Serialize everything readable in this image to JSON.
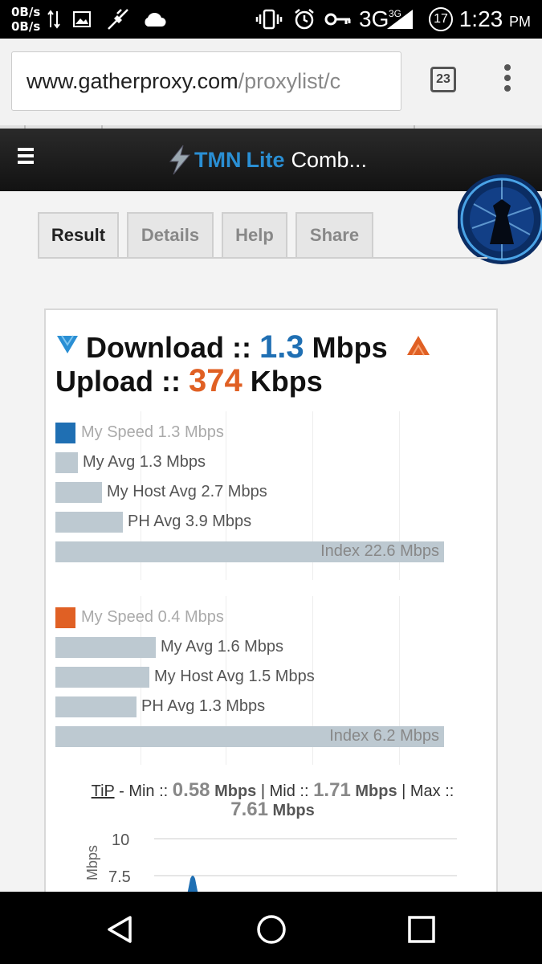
{
  "status": {
    "net_up": "0B/s",
    "net_down": "0B/s",
    "network": "3G",
    "network_small": "3G",
    "badge": "17",
    "time": "1:23",
    "ampm": "PM"
  },
  "browser": {
    "url_domain": "www.gatherproxy.com",
    "url_path": "/proxylist/c",
    "tab_count": "23"
  },
  "header": {
    "brand_tmn": "TMN",
    "brand_lite": "Lite",
    "brand_rest": "Comb..."
  },
  "tabs": [
    {
      "label": "Result",
      "active": true
    },
    {
      "label": "Details",
      "active": false
    },
    {
      "label": "Help",
      "active": false
    },
    {
      "label": "Share",
      "active": false
    }
  ],
  "result": {
    "download_label": "Download ::",
    "download_value": "1.3",
    "download_unit": "Mbps",
    "upload_label": "Upload ::",
    "upload_value": "374",
    "upload_unit": "Kbps"
  },
  "download_bars": [
    {
      "label": "My Speed 1.3 Mbps",
      "value": 1.3
    },
    {
      "label": "My Avg 1.3 Mbps",
      "value": 1.3
    },
    {
      "label": "My Host Avg 2.7 Mbps",
      "value": 2.7
    },
    {
      "label": "PH Avg 3.9 Mbps",
      "value": 3.9
    },
    {
      "label": "Index 22.6 Mbps",
      "value": 22.6
    }
  ],
  "upload_bars": [
    {
      "label": "My Speed 0.4 Mbps",
      "value": 0.4
    },
    {
      "label": "My Avg 1.6 Mbps",
      "value": 1.6
    },
    {
      "label": "My Host Avg 1.5 Mbps",
      "value": 1.5
    },
    {
      "label": "PH Avg 1.3 Mbps",
      "value": 1.3
    },
    {
      "label": "Index 6.2 Mbps",
      "value": 6.2
    }
  ],
  "tip": {
    "tip_word": "TiP",
    "min_label": "- Min ::",
    "min_value": "0.58",
    "mid_label": "| Mid ::",
    "mid_value": "1.71",
    "max_label": "| Max ::",
    "max_value": "7.61",
    "unit": "Mbps"
  },
  "chart_data": {
    "type": "line",
    "ylabel": "Mbps",
    "y_ticks": [
      "10",
      "7.5"
    ],
    "ylim": [
      0,
      10
    ]
  },
  "colors": {
    "download": "#1f6fb3",
    "upload": "#e06024",
    "bar": "#bdc9d1"
  }
}
